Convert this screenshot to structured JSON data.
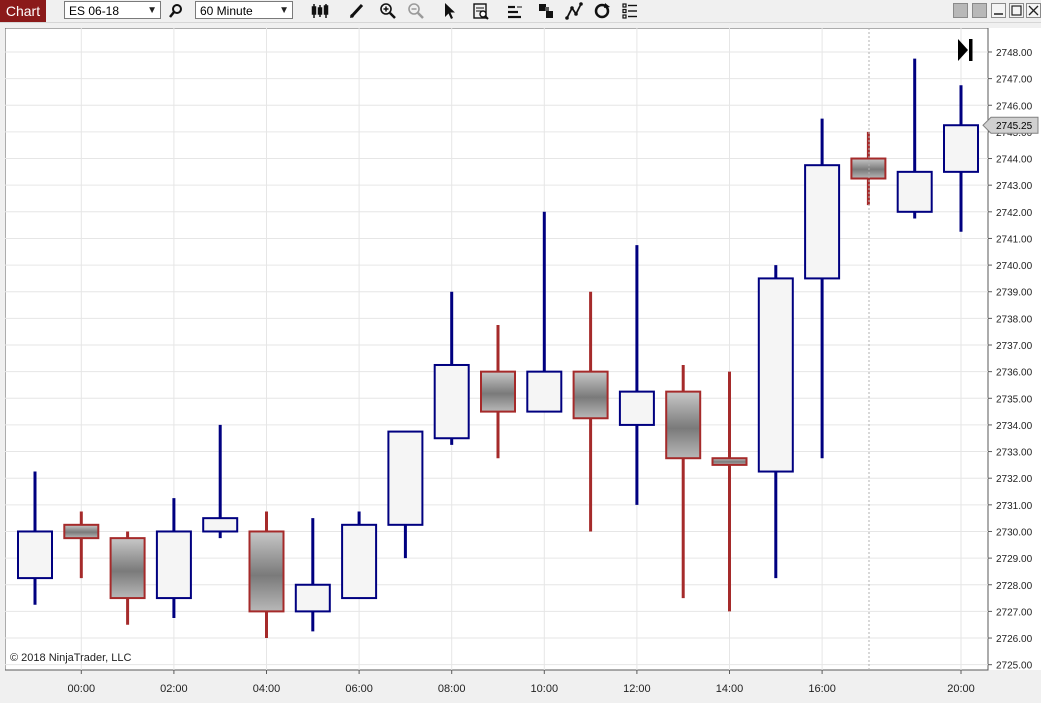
{
  "toolbar": {
    "tab_label": "Chart",
    "instrument": "ES 06-18",
    "interval": "60 Minute",
    "icons": [
      "search-icon",
      "bar-type-icon",
      "draw-pencil-icon",
      "zoom-in-icon",
      "zoom-out-icon",
      "pointer-icon",
      "data-box-icon",
      "strategies-icon",
      "indicators-icon",
      "drawing-tools-icon",
      "reload-icon",
      "properties-icon"
    ],
    "window_icons": [
      "tile-icon",
      "tile-icon",
      "minimize-icon",
      "maximize-icon",
      "close-icon"
    ]
  },
  "copyright": "© 2018 NinjaTrader, LLC",
  "colors": {
    "up_border": "#000080",
    "down_border": "#a52a2a",
    "up_fill": "#f5f5f5",
    "grid": "#e6e6e6"
  },
  "chart_data": {
    "type": "candlestick",
    "ylim": [
      2724.8,
      2748.9
    ],
    "y_ticks": [
      2725,
      2726,
      2727,
      2728,
      2729,
      2730,
      2731,
      2732,
      2733,
      2734,
      2735,
      2736,
      2737,
      2738,
      2739,
      2740,
      2741,
      2742,
      2743,
      2744,
      2745,
      2746,
      2747,
      2748
    ],
    "x_ticks": [
      "00:00",
      "02:00",
      "04:00",
      "06:00",
      "08:00",
      "10:00",
      "12:00",
      "14:00",
      "16:00",
      "20:00"
    ],
    "last_price": "2745.25",
    "bars": [
      {
        "o": 2728.25,
        "h": 2732.25,
        "l": 2727.25,
        "c": 2730.0
      },
      {
        "o": 2730.25,
        "h": 2730.75,
        "l": 2728.25,
        "c": 2729.75
      },
      {
        "o": 2729.75,
        "h": 2730.0,
        "l": 2726.5,
        "c": 2727.5
      },
      {
        "o": 2727.5,
        "h": 2731.25,
        "l": 2726.75,
        "c": 2730.0
      },
      {
        "o": 2730.0,
        "h": 2734.0,
        "l": 2729.75,
        "c": 2730.5
      },
      {
        "o": 2730.0,
        "h": 2730.75,
        "l": 2726.0,
        "c": 2727.0
      },
      {
        "o": 2727.0,
        "h": 2730.5,
        "l": 2726.25,
        "c": 2728.0
      },
      {
        "o": 2727.5,
        "h": 2730.75,
        "l": 2727.5,
        "c": 2730.25
      },
      {
        "o": 2730.25,
        "h": 2733.75,
        "l": 2729.0,
        "c": 2733.75
      },
      {
        "o": 2733.5,
        "h": 2739.0,
        "l": 2733.25,
        "c": 2736.25
      },
      {
        "o": 2736.0,
        "h": 2737.75,
        "l": 2732.75,
        "c": 2734.5
      },
      {
        "o": 2734.5,
        "h": 2742.0,
        "l": 2734.5,
        "c": 2736.0
      },
      {
        "o": 2736.0,
        "h": 2739.0,
        "l": 2730.0,
        "c": 2734.25
      },
      {
        "o": 2734.0,
        "h": 2740.75,
        "l": 2731.0,
        "c": 2735.25
      },
      {
        "o": 2735.25,
        "h": 2736.25,
        "l": 2727.5,
        "c": 2732.75
      },
      {
        "o": 2732.75,
        "h": 2736.0,
        "l": 2727.0,
        "c": 2732.5
      },
      {
        "o": 2732.25,
        "h": 2740.0,
        "l": 2728.25,
        "c": 2739.5
      },
      {
        "o": 2739.5,
        "h": 2745.5,
        "l": 2732.75,
        "c": 2743.75
      },
      {
        "o": 2744.0,
        "h": 2745.0,
        "l": 2742.25,
        "c": 2743.25
      },
      {
        "o": 2742.0,
        "h": 2747.75,
        "l": 2741.75,
        "c": 2743.5
      },
      {
        "o": 2743.5,
        "h": 2746.75,
        "l": 2741.25,
        "c": 2745.25
      }
    ]
  }
}
